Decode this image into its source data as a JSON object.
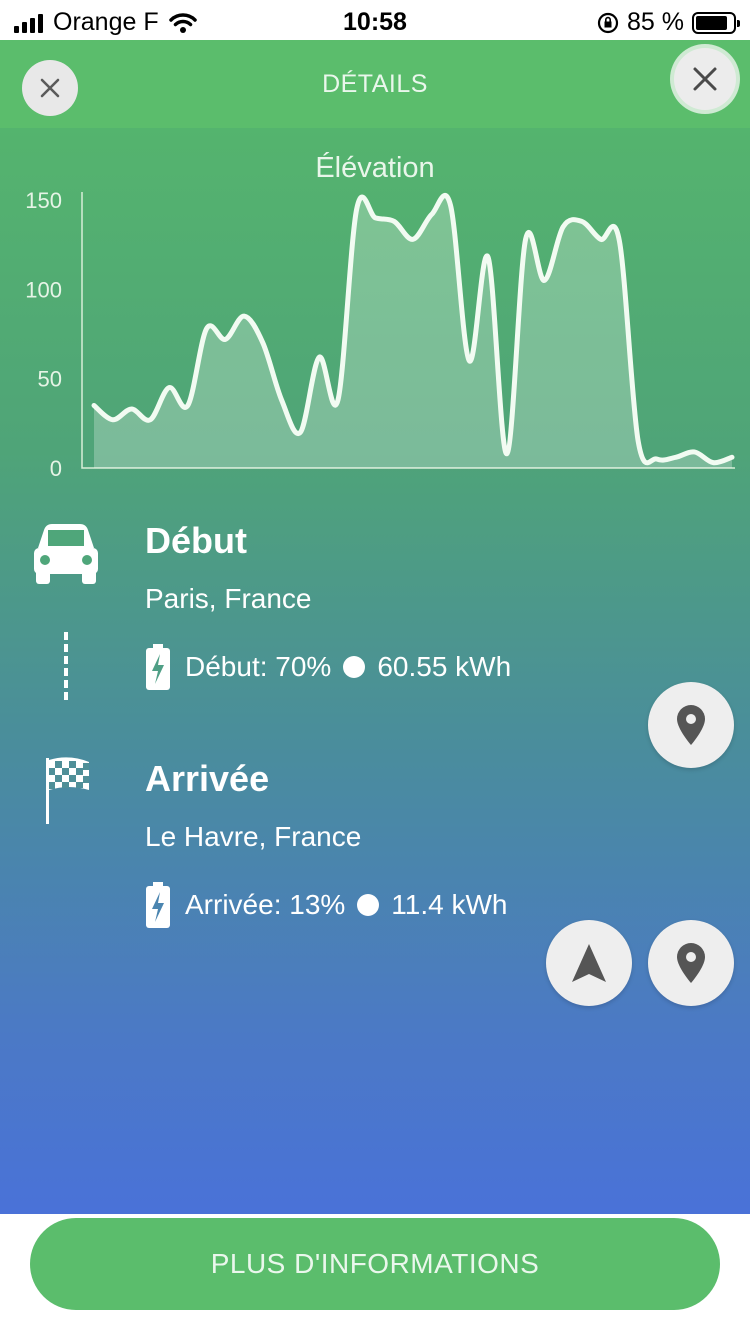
{
  "status_bar": {
    "carrier": "Orange F",
    "time": "10:58",
    "battery_percent": "85 %",
    "battery_level": 0.85
  },
  "header": {
    "title": "DÉTAILS",
    "left_button_icon": "close-icon",
    "right_button_icon": "close-icon"
  },
  "chart_data": {
    "type": "area",
    "title": "Élévation",
    "xlabel": "",
    "ylabel": "",
    "ylim": [
      0,
      150
    ],
    "yticks": [
      0,
      50,
      100,
      150
    ],
    "grid": false,
    "series": [
      {
        "values": [
          35,
          27,
          33,
          27,
          45,
          35,
          78,
          72,
          85,
          70,
          38,
          20,
          62,
          38,
          145,
          140,
          138,
          128,
          142,
          147,
          60,
          118,
          8,
          128,
          105,
          135,
          138,
          128,
          127,
          15,
          5,
          6,
          9,
          3,
          6
        ]
      }
    ],
    "colors": {
      "line": "#f2fbf2",
      "fill": "rgba(255,255,255,0.25)",
      "axis": "#d8eed8"
    }
  },
  "trip": {
    "start": {
      "icon": "car-icon",
      "title": "Début",
      "place": "Paris, France",
      "charge_label": "Début: 70%",
      "energy": "60.55 kWh"
    },
    "end": {
      "icon": "checkered-flag-icon",
      "title": "Arrivée",
      "place": "Le Havre, France",
      "charge_label": "Arrivée: 13%",
      "energy": "11.4 kWh"
    }
  },
  "footer": {
    "button_label": "PLUS D'INFORMATIONS"
  }
}
